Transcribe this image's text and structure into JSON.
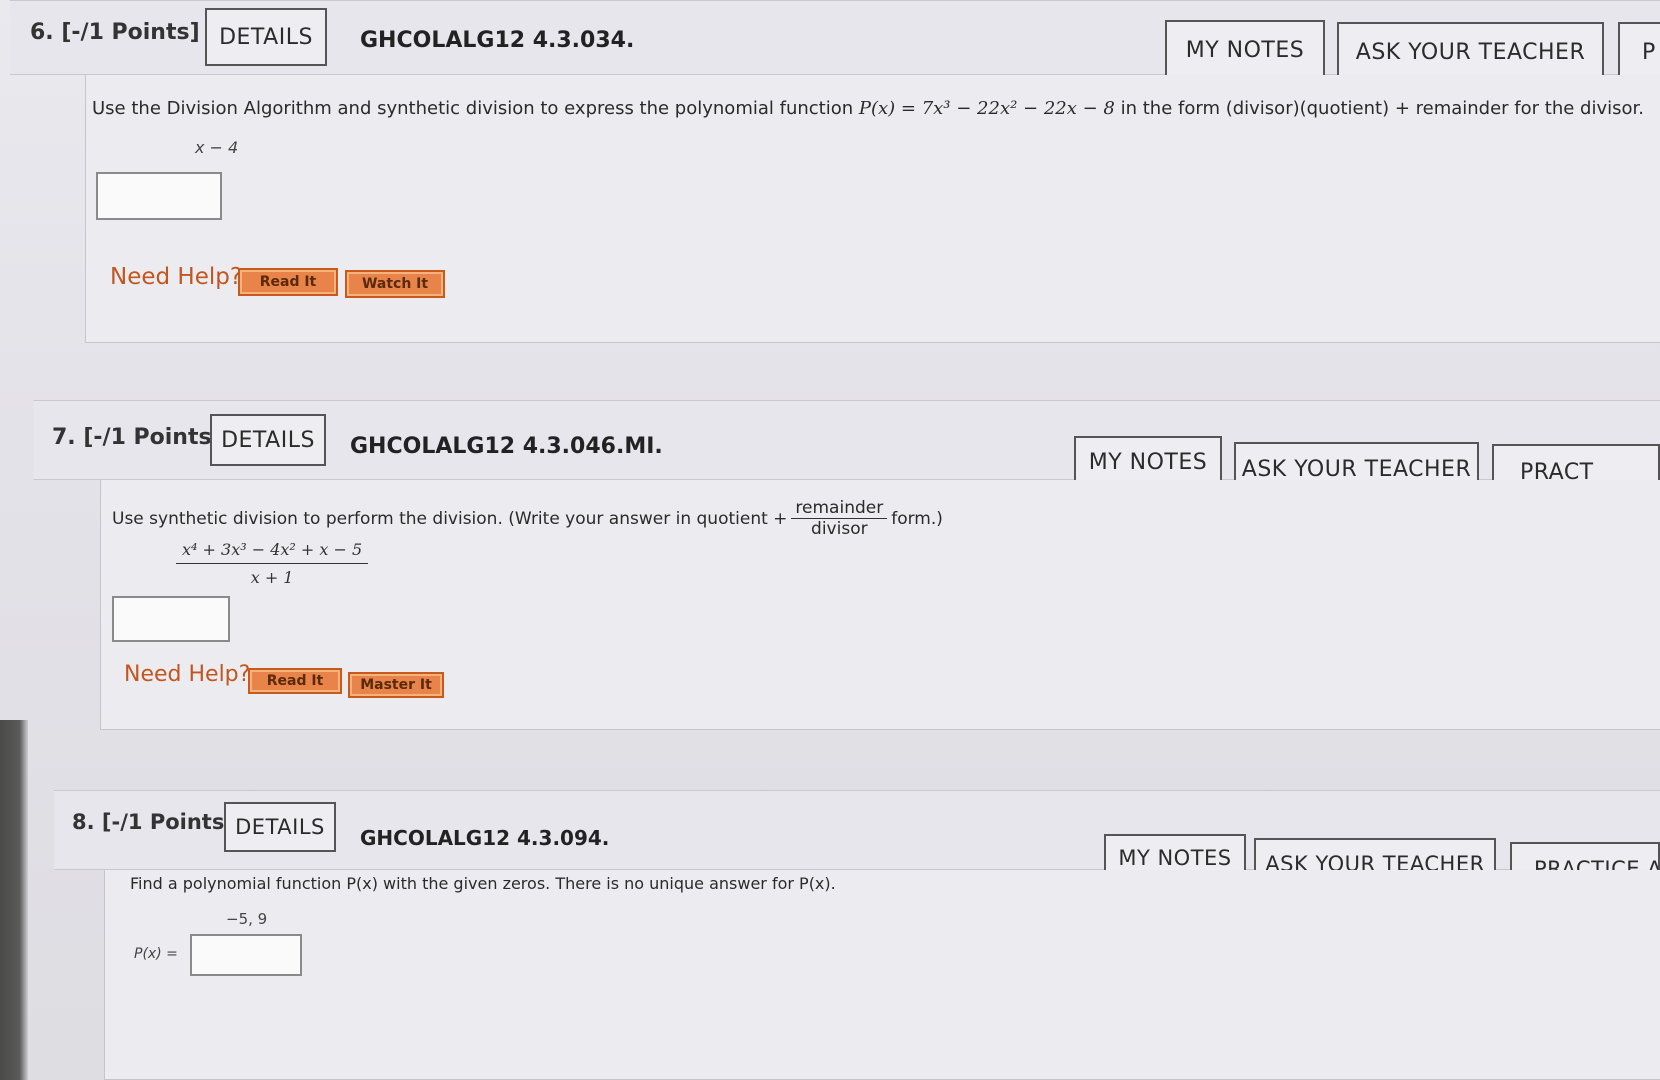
{
  "questions": [
    {
      "number": "6.",
      "points": "[-/1 Points]",
      "details": "DETAILS",
      "code": "GHCOLALG12 4.3.034.",
      "buttons": {
        "notes": "MY NOTES",
        "teacher": "ASK YOUR TEACHER",
        "practice": "P"
      },
      "prompt_a": "Use the Division Algorithm and synthetic division to express the polynomial function ",
      "prompt_math": "P(x) = 7x³ − 22x² − 22x − 8",
      "prompt_b": " in the form (divisor)(quotient) + remainder for the divisor.",
      "divisor": "x − 4",
      "need_help": "Need Help?",
      "help_buttons": [
        "Read It",
        "Watch It"
      ]
    },
    {
      "number": "7.",
      "points": "[-/1 Points]",
      "details": "DETAILS",
      "code": "GHCOLALG12 4.3.046.MI.",
      "buttons": {
        "notes": "MY NOTES",
        "teacher": "ASK YOUR TEACHER",
        "practice": "PRACT"
      },
      "prompt_a": "Use synthetic division to perform the division. (Write your answer in quotient + ",
      "frac_num": "remainder",
      "frac_den": "divisor",
      "prompt_b": " form.)",
      "expr_num": "x⁴ + 3x³ − 4x² + x − 5",
      "expr_den": "x + 1",
      "need_help": "Need Help?",
      "help_buttons": [
        "Read It",
        "Master It"
      ]
    },
    {
      "number": "8.",
      "points": "[-/1 Points]",
      "details": "DETAILS",
      "code": "GHCOLALG12 4.3.094.",
      "buttons": {
        "notes": "MY NOTES",
        "teacher": "ASK YOUR TEACHER",
        "practice": "PRACTICE AI"
      },
      "prompt": "Find a polynomial function P(x) with the given zeros. There is no unique answer for P(x).",
      "zeros": "−5, 9",
      "answer_label": "P(x) ="
    }
  ]
}
